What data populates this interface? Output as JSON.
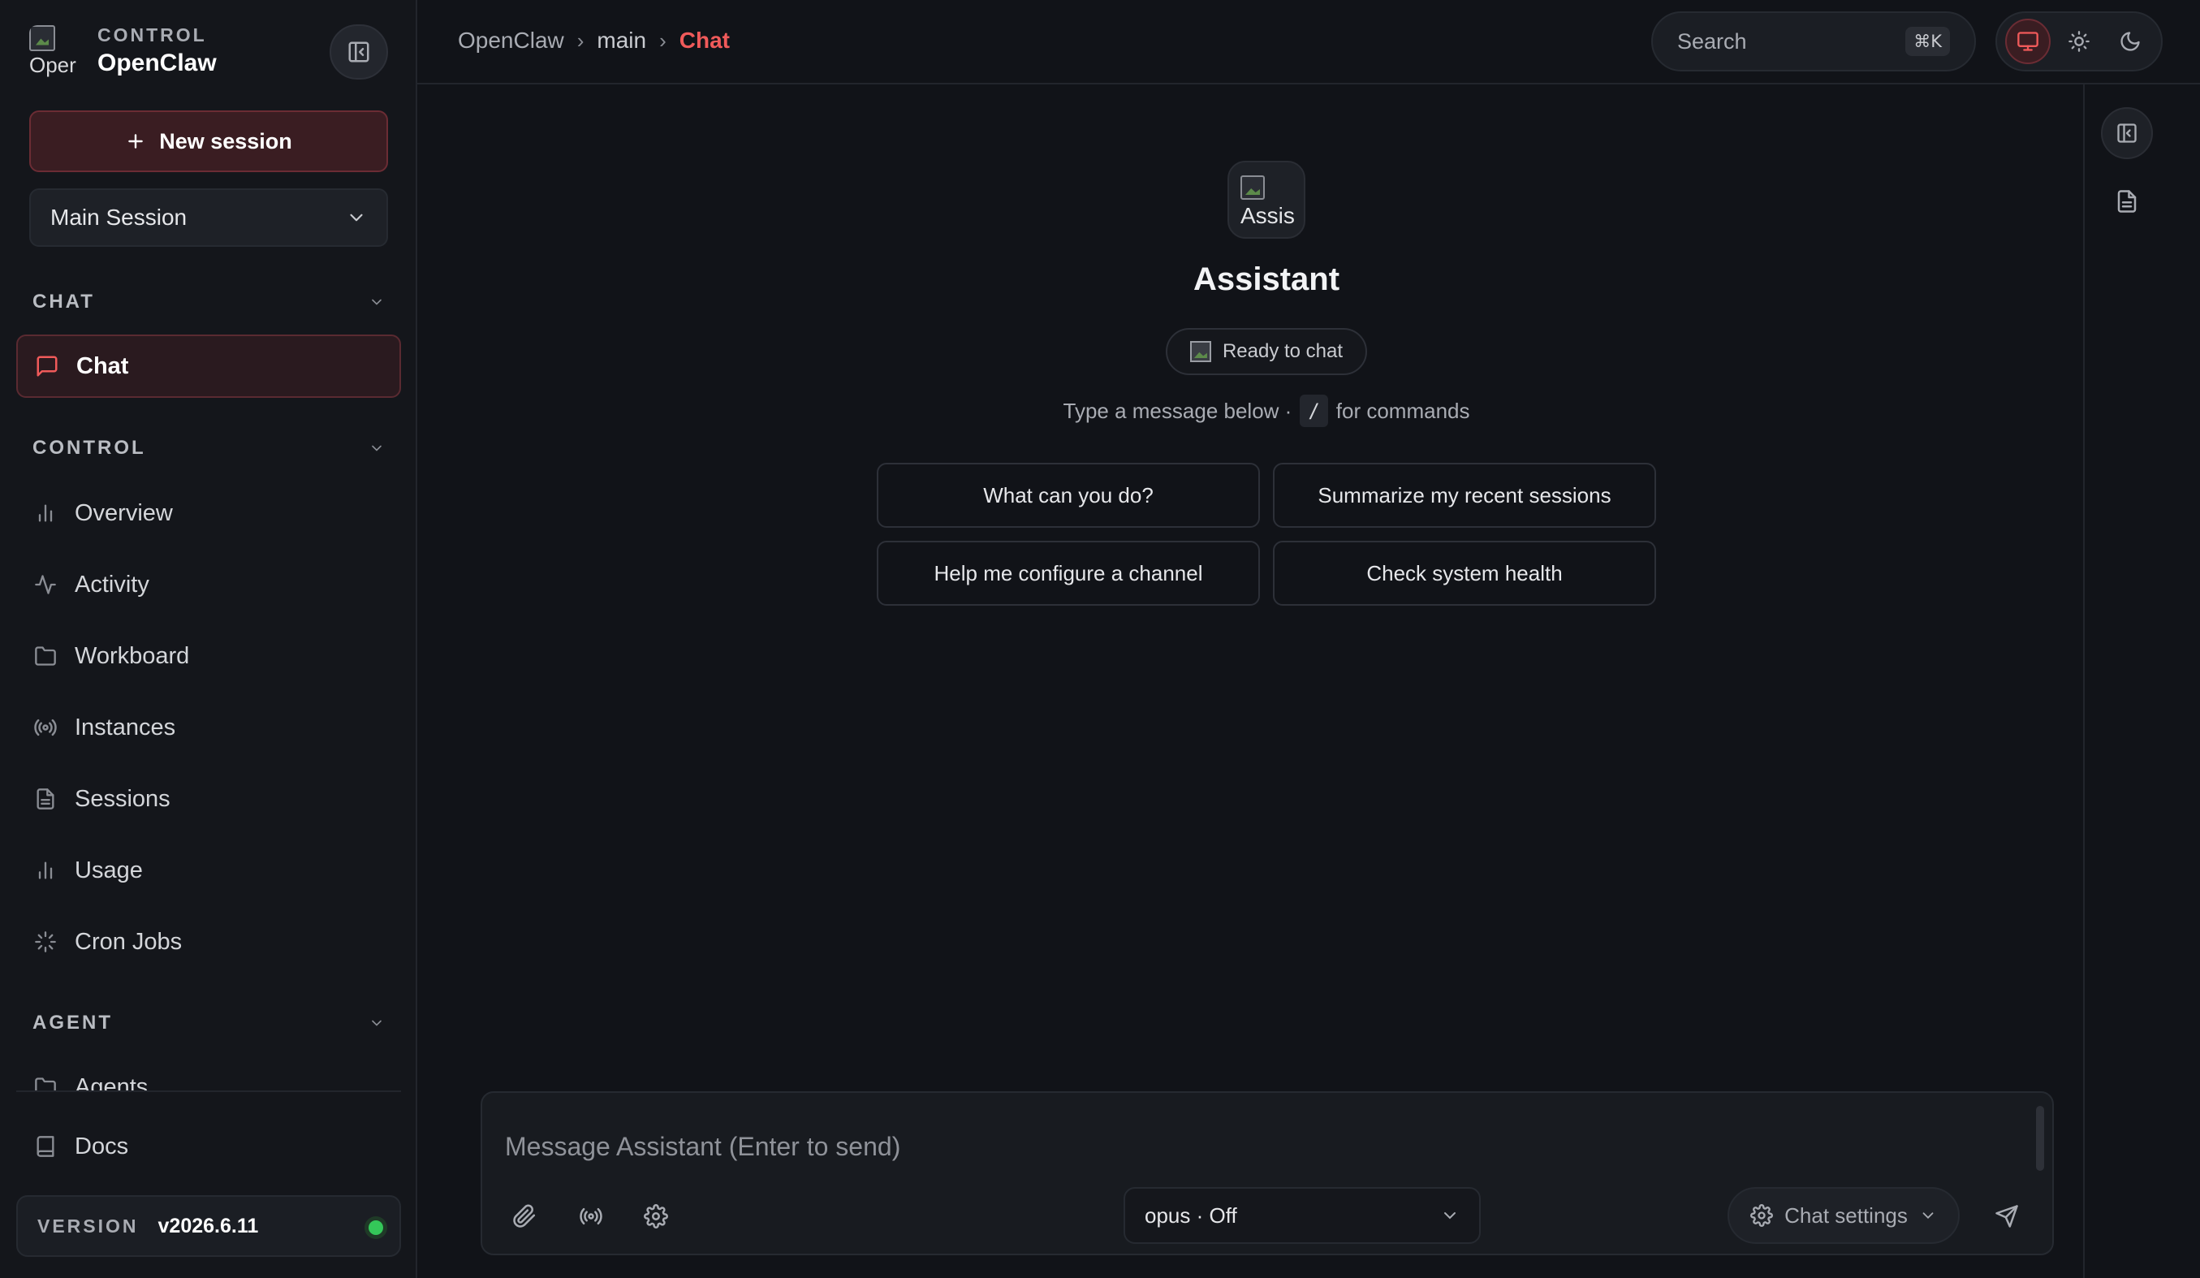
{
  "brand": {
    "eyebrow": "CONTROL",
    "name": "OpenClaw",
    "logo_alt": "Oper"
  },
  "sidebar": {
    "new_session_label": "New session",
    "session_select_value": "Main Session",
    "sections": {
      "chat": "CHAT",
      "control": "CONTROL",
      "agent": "AGENT"
    },
    "chat_items": [
      {
        "label": "Chat",
        "icon": "chat-bubble-icon"
      }
    ],
    "control_items": [
      {
        "label": "Overview",
        "icon": "bar-chart-icon"
      },
      {
        "label": "Activity",
        "icon": "activity-icon"
      },
      {
        "label": "Workboard",
        "icon": "folder-icon"
      },
      {
        "label": "Instances",
        "icon": "radio-icon"
      },
      {
        "label": "Sessions",
        "icon": "document-icon"
      },
      {
        "label": "Usage",
        "icon": "bar-chart-icon"
      },
      {
        "label": "Cron Jobs",
        "icon": "loader-icon"
      }
    ],
    "agent_items": [
      {
        "label": "Agents",
        "icon": "folder-icon"
      }
    ],
    "docs_label": "Docs",
    "version_label": "VERSION",
    "version_value": "v2026.6.11"
  },
  "topbar": {
    "breadcrumb": [
      "OpenClaw",
      "main",
      "Chat"
    ],
    "search_placeholder": "Search",
    "search_shortcut": "⌘K"
  },
  "main": {
    "assistant_name": "Assistant",
    "avatar_alt": "Assis",
    "status": "Ready to chat",
    "hint_before": "Type a message below ·",
    "hint_key": "/",
    "hint_after": "for commands",
    "suggestions": [
      "What can you do?",
      "Summarize my recent sessions",
      "Help me configure a channel",
      "Check system health"
    ]
  },
  "composer": {
    "placeholder": "Message Assistant (Enter to send)",
    "model_value": "opus · Off",
    "chat_settings_label": "Chat settings"
  },
  "colors": {
    "accent": "#f05a5a",
    "background": "#111318",
    "sidebar": "#14161b",
    "status_online": "#34c759"
  }
}
